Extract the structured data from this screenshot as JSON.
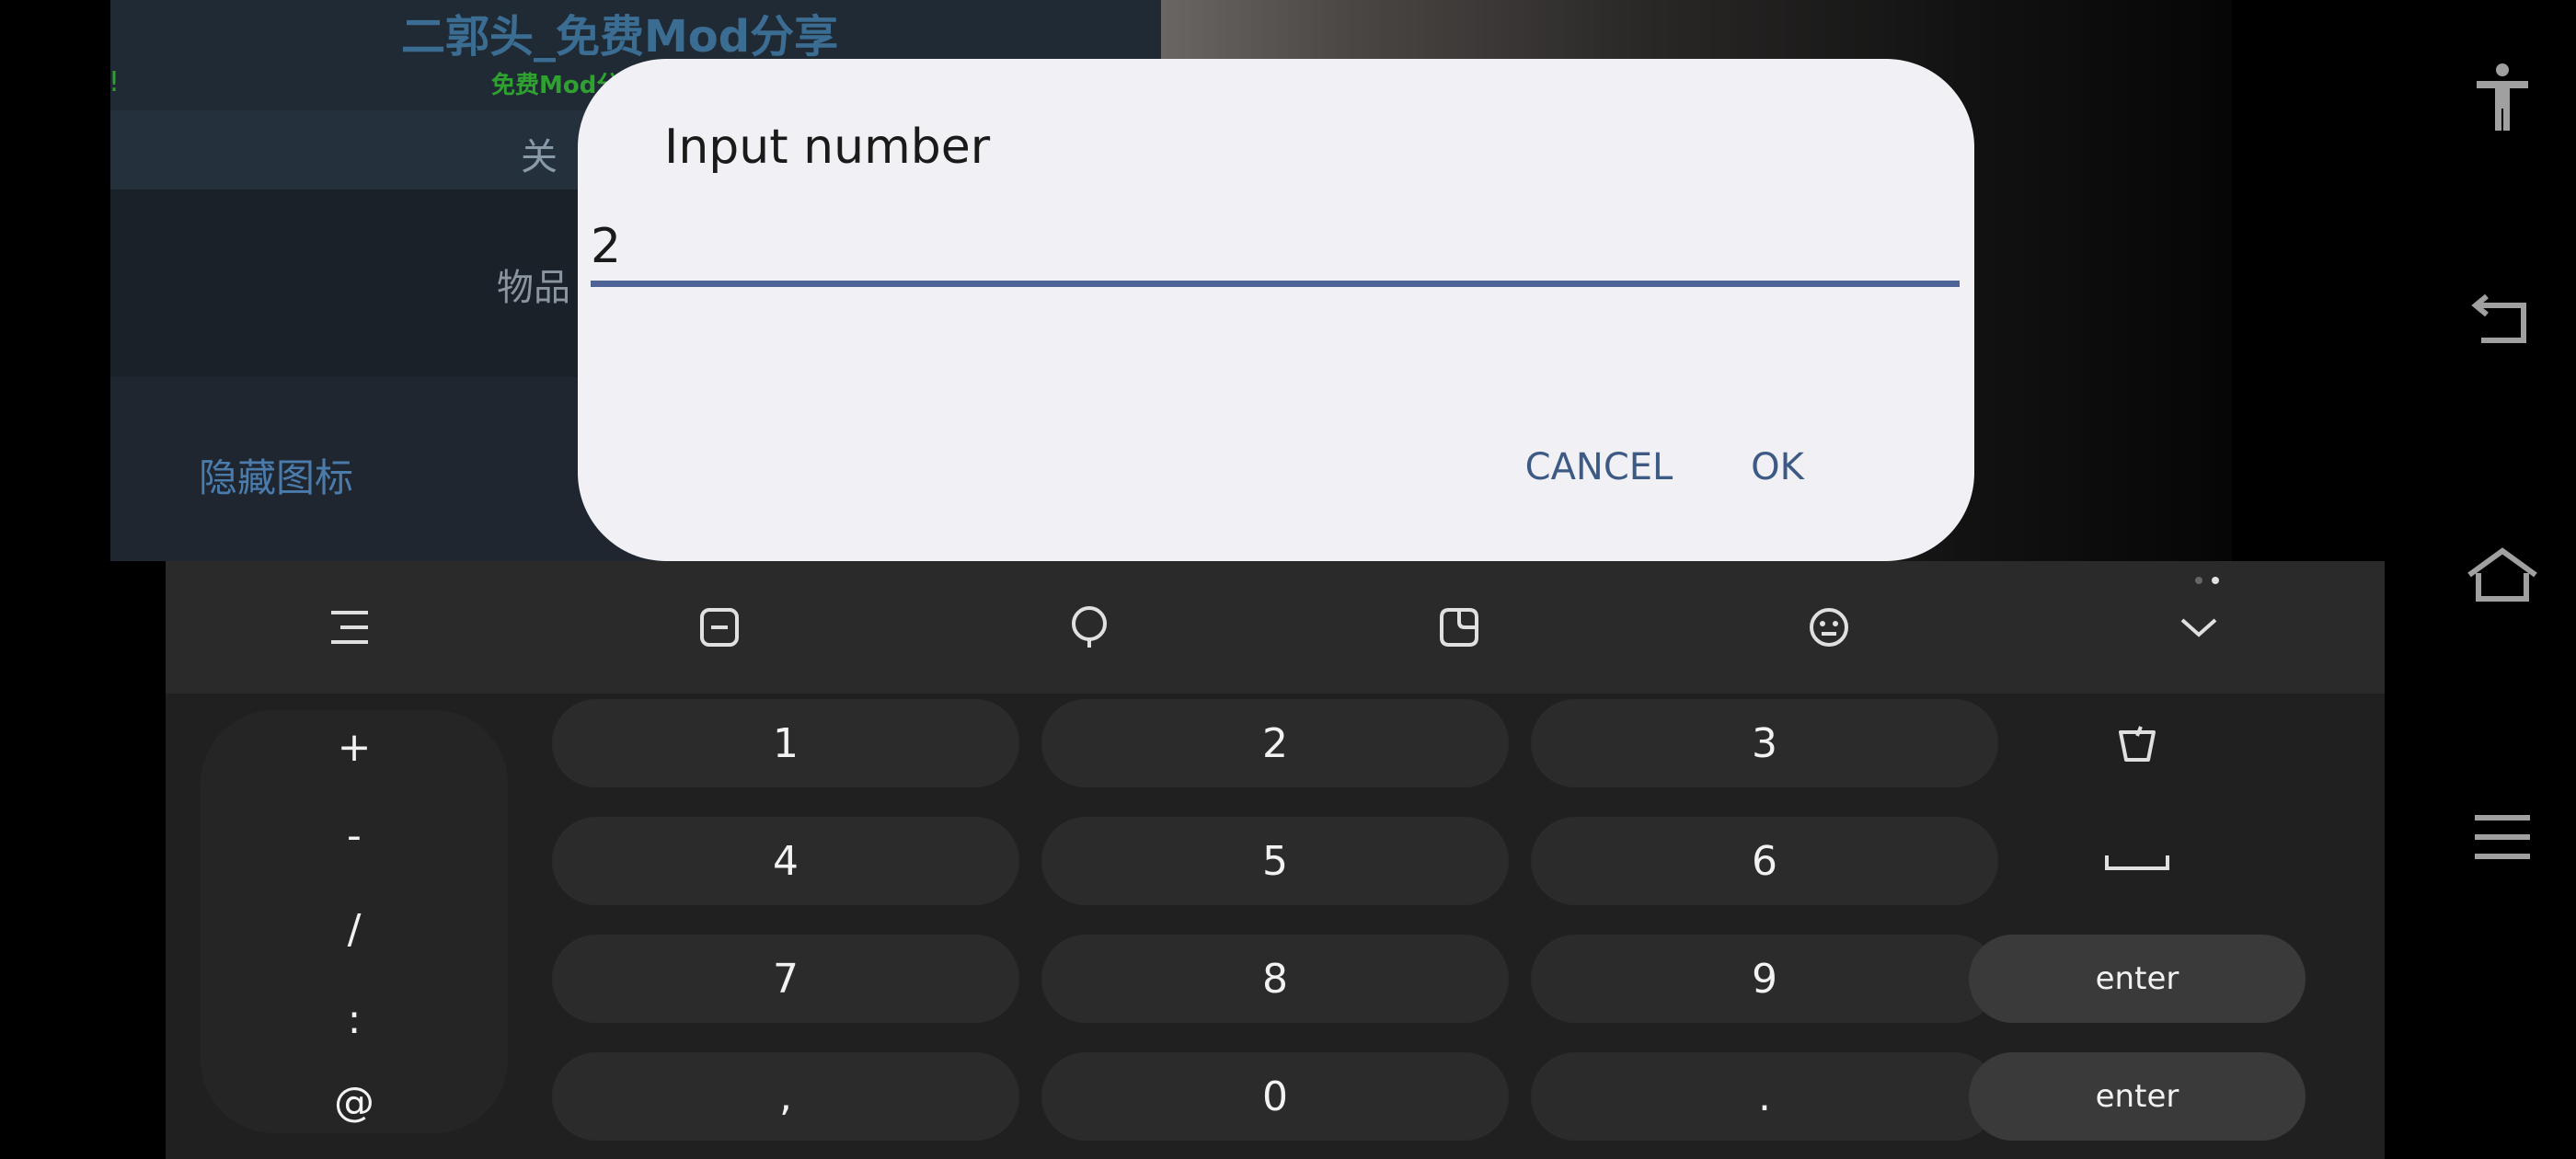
{
  "background_app": {
    "title": "二郭头_免费Mod分享",
    "subtitle": "免费Mod分",
    "left_fragment": "!",
    "tab_label": "关",
    "item_label": "物品",
    "hide_icon_label": "隐藏图标"
  },
  "dialog": {
    "title": "Input number",
    "input_value": "2",
    "cancel_label": "CANCEL",
    "ok_label": "OK",
    "accent_color": "#4e6396"
  },
  "keyboard": {
    "toolbar_icons": [
      "menu-icon",
      "clipboard-icon",
      "voice-icon",
      "sticker-icon",
      "emoji-icon",
      "collapse-keyboard-icon"
    ],
    "symbol_keys": [
      "+",
      "-",
      "/",
      ":",
      "@"
    ],
    "number_rows": [
      [
        "1",
        "2",
        "3"
      ],
      [
        "4",
        "5",
        "6"
      ],
      [
        "7",
        "8",
        "9"
      ],
      [
        ",",
        "0",
        "."
      ]
    ],
    "backspace_icon": "backspace-icon",
    "space_icon": "space-icon",
    "enter_label": "enter",
    "enter_label_2": "enter"
  },
  "system_nav": {
    "icons": [
      "accessibility-icon",
      "back-icon",
      "home-icon",
      "recents-menu-icon"
    ]
  }
}
